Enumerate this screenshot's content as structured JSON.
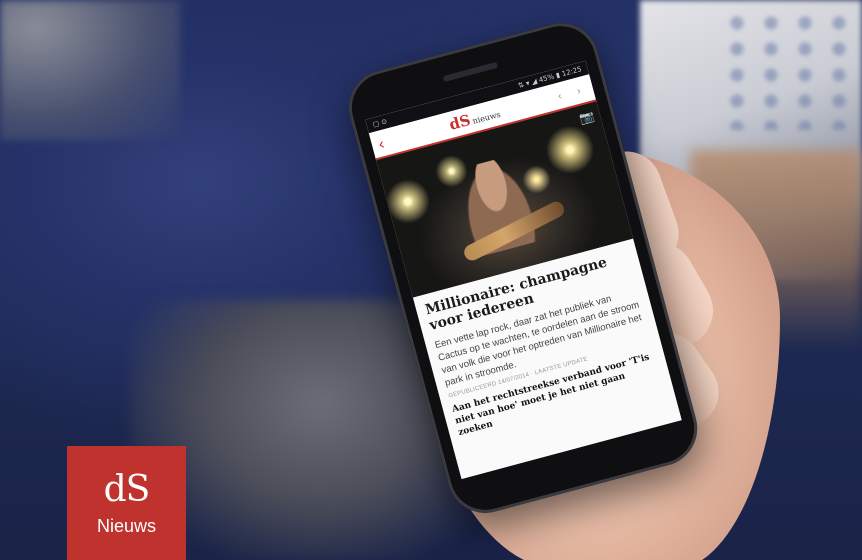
{
  "phone": {
    "status_left": "▢ ⊙",
    "status_right": "⇅ ▾ ◢ 45% ▮ 12:25",
    "app": {
      "back_glyph": "‹",
      "brand_mark": "dS",
      "brand_word": "nieuws",
      "nav_glyphs": "‹ ›"
    },
    "hero": {
      "camera_glyph": "📷"
    },
    "article": {
      "headline": "Millionaire: champagne voor iedereen",
      "lead": "Een vette lap rock, daar zat het publiek van Cactus op te wachten, te oordelen aan de stroom van volk die voor het optreden van Millionaire het park in stroomde.",
      "meta": "GEPUBLICEERD 14/07/2014 · LAATSTE UPDATE",
      "body": "Aan het rechtstreekse verband voor 'T'is niet van hoe' moet je het niet gaan zoeken"
    }
  },
  "logo": {
    "mark": "dS",
    "word": "Nieuws"
  },
  "colors": {
    "brand_red": "#c0322e",
    "shirt_blue": "#1f2c5c"
  }
}
